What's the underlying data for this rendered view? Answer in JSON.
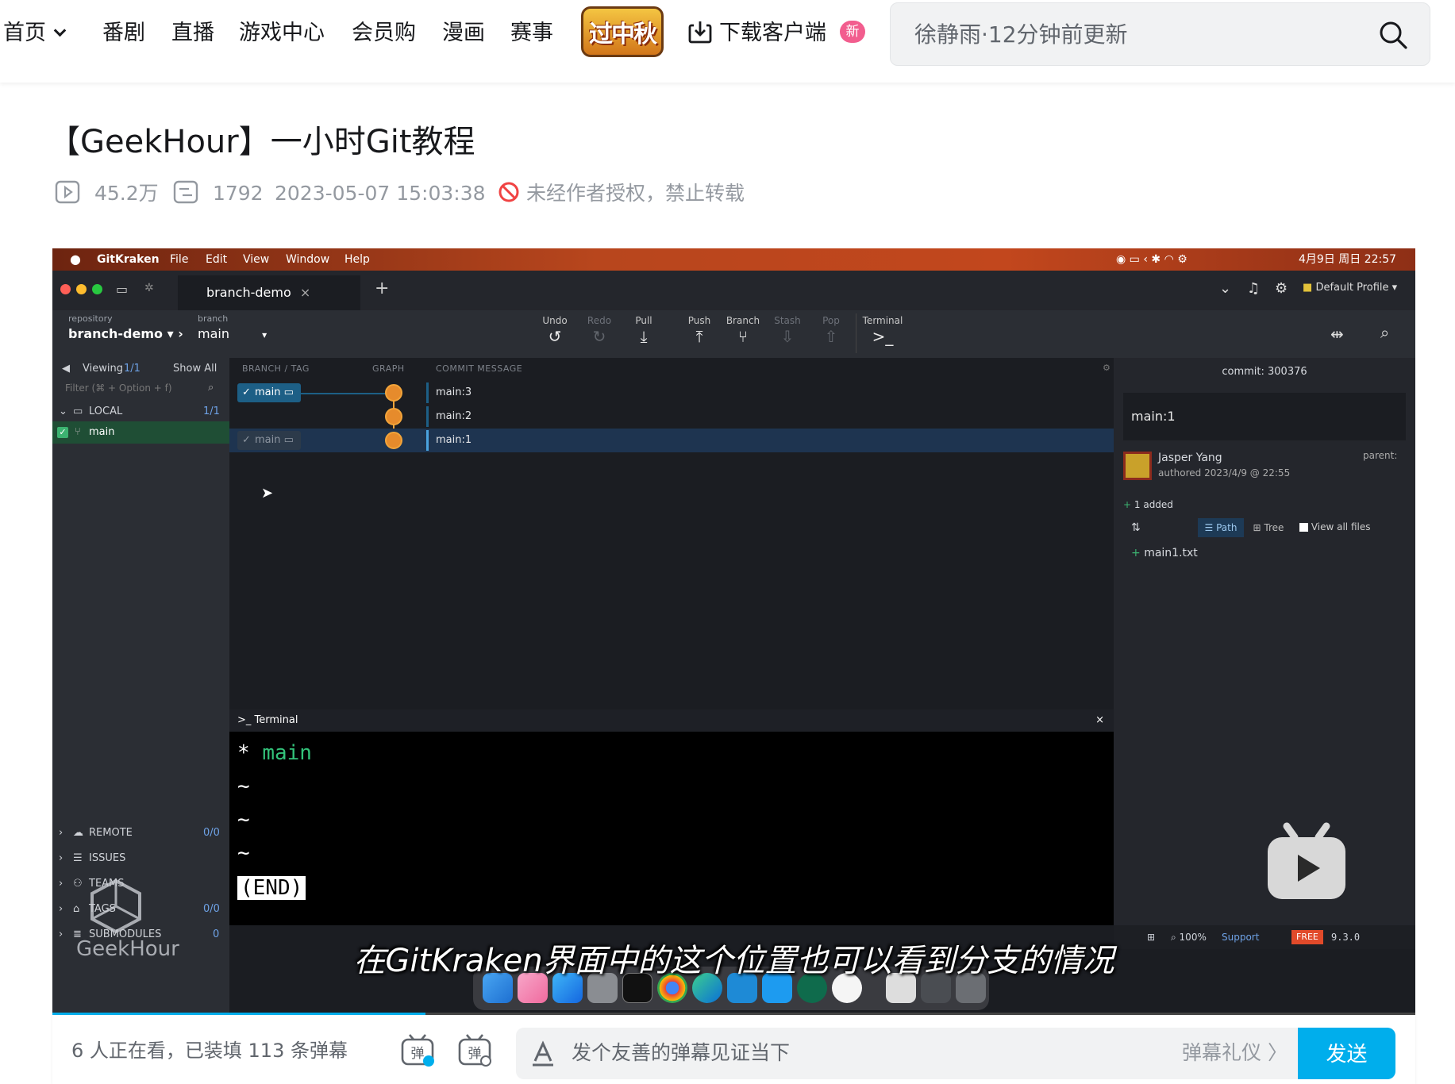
{
  "nav": {
    "home": "首页",
    "items": [
      "番剧",
      "直播",
      "游戏中心",
      "会员购",
      "漫画",
      "赛事"
    ],
    "festival": "过中秋",
    "download": "下载客户端",
    "new_badge": "新",
    "search_placeholder": "徐静雨·12分钟前更新"
  },
  "video": {
    "title": "【GeekHour】一小时Git教程",
    "views": "45.2万",
    "danmaku_count": "1792",
    "date": "2023-05-07 15:03:38",
    "copyright": "未经作者授权，禁止转载"
  },
  "frame": {
    "mac_menu": [
      "GitKraken",
      "File",
      "Edit",
      "View",
      "Window",
      "Help"
    ],
    "mac_clock": "4月9日 周日 22:57",
    "tab_name": "branch-demo",
    "profile": "Default Profile",
    "repo_label": "repository",
    "repo_name": "branch-demo",
    "branch_label": "branch",
    "branch_name": "main",
    "toolbar": [
      {
        "label": "Undo",
        "icon": "↺",
        "enabled": true
      },
      {
        "label": "Redo",
        "icon": "↻",
        "enabled": false
      },
      {
        "label": "Pull",
        "icon": "⤓",
        "enabled": true
      },
      {
        "label": "Push",
        "icon": "⤒",
        "enabled": true
      },
      {
        "label": "Branch",
        "icon": "⑂",
        "enabled": true
      },
      {
        "label": "Stash",
        "icon": "⇩",
        "enabled": false
      },
      {
        "label": "Pop",
        "icon": "⇧",
        "enabled": false
      }
    ],
    "terminal_btn": "Terminal",
    "viewing": "Viewing",
    "viewing_count": "1/1",
    "show_all": "Show All",
    "filter_ph": "Filter (⌘ + Option + f)",
    "local": "LOCAL",
    "local_count": "1/1",
    "local_branch": "main",
    "sections": [
      {
        "name": "REMOTE",
        "count": "0/0"
      },
      {
        "name": "ISSUES",
        "count": ""
      },
      {
        "name": "TEAMS",
        "count": ""
      },
      {
        "name": "TAGS",
        "count": "0/0"
      },
      {
        "name": "SUBMODULES",
        "count": "0"
      }
    ],
    "col_branch": "BRANCH / TAG",
    "col_graph": "GRAPH",
    "col_msg": "COMMIT MESSAGE",
    "commits": [
      "main:3",
      "main:2",
      "main:1"
    ],
    "pill_label": "main",
    "terminal_title": "Terminal",
    "terminal_lines": {
      "star": "*",
      "branch": "main",
      "tilde": "~",
      "end": "(END)"
    },
    "commit_hash_label": "commit: 300376",
    "commit_title": "main:1",
    "author": "Jasper Yang",
    "authored": "authored 2023/4/9 @ 22:55",
    "parent": "parent:",
    "added": "1 added",
    "path_btn": "Path",
    "tree_btn": "Tree",
    "view_all": "View all files",
    "file": "main1.txt",
    "zoom": "100%",
    "support": "Support",
    "free": "FREE",
    "version": "9.3.0",
    "subtitle": "在GitKraken界面中的这个位置也可以看到分支的情况",
    "watermark": "GeekHour"
  },
  "danmaku": {
    "watching": "6 人正在看，已装填 113 条弹幕",
    "placeholder": "发个友善的弹幕见证当下",
    "etiquette": "弹幕礼仪 〉",
    "send": "发送"
  },
  "colors": {
    "accent": "#00aeec",
    "pink": "#f25d8e",
    "gk_blue": "#1d5f86"
  }
}
